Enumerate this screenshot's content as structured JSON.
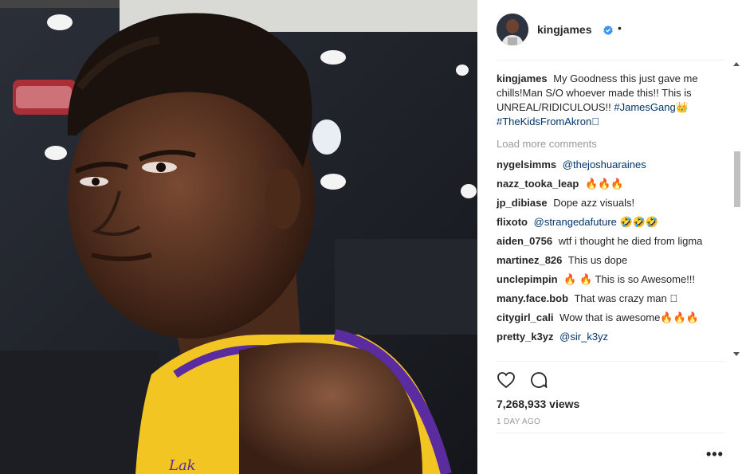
{
  "post": {
    "username": "kingjames",
    "verified_icon": "verified-badge-icon",
    "header_dot": "•",
    "caption": {
      "username": "kingjames",
      "text": "My Goodness this just gave me chills!Man S/O whoever made this!! This is UNREAL/RIDICULOUS!!",
      "hashtag1": "#JamesGang",
      "emoji1": "👑",
      "hashtag2": "#TheKidsFromAkron",
      "emoji2": "🏾"
    },
    "load_more": "Load more comments",
    "comments": [
      {
        "user": "nygelsimms",
        "mention": "@thejoshuaraines",
        "text": ""
      },
      {
        "user": "nazz_tooka_leap",
        "mention": "",
        "text": "🔥🔥🔥"
      },
      {
        "user": "jp_dibiase",
        "mention": "",
        "text": "Dope azz visuals!"
      },
      {
        "user": "flixoto",
        "mention": "@strangedafuture",
        "text": "🤣🤣🤣"
      },
      {
        "user": "aiden_0756",
        "mention": "",
        "text": "wtf i thought he died from ligma"
      },
      {
        "user": "martinez_826",
        "mention": "",
        "text": "This us dope"
      },
      {
        "user": "unclepimpin",
        "mention": "",
        "text": "🔥 🔥 This is so Awesome!!!"
      },
      {
        "user": "many.face.bob",
        "mention": "",
        "text": "That was crazy man 🏾"
      },
      {
        "user": "citygirl_cali",
        "mention": "",
        "text": "Wow that is awesome🔥🔥🔥"
      },
      {
        "user": "pretty_k3yz",
        "mention": "@sir_k3yz",
        "text": ""
      }
    ],
    "views": "7,268,933 views",
    "time_ago": "1 DAY AGO",
    "more_options": "•••",
    "icons": {
      "like": "heart-icon",
      "comment": "comment-bubble-icon"
    },
    "colors": {
      "accent_verified": "#3897f0",
      "hashtag": "#003569",
      "jersey_yellow": "#f2c522",
      "jersey_purple": "#5b2ca0"
    }
  }
}
